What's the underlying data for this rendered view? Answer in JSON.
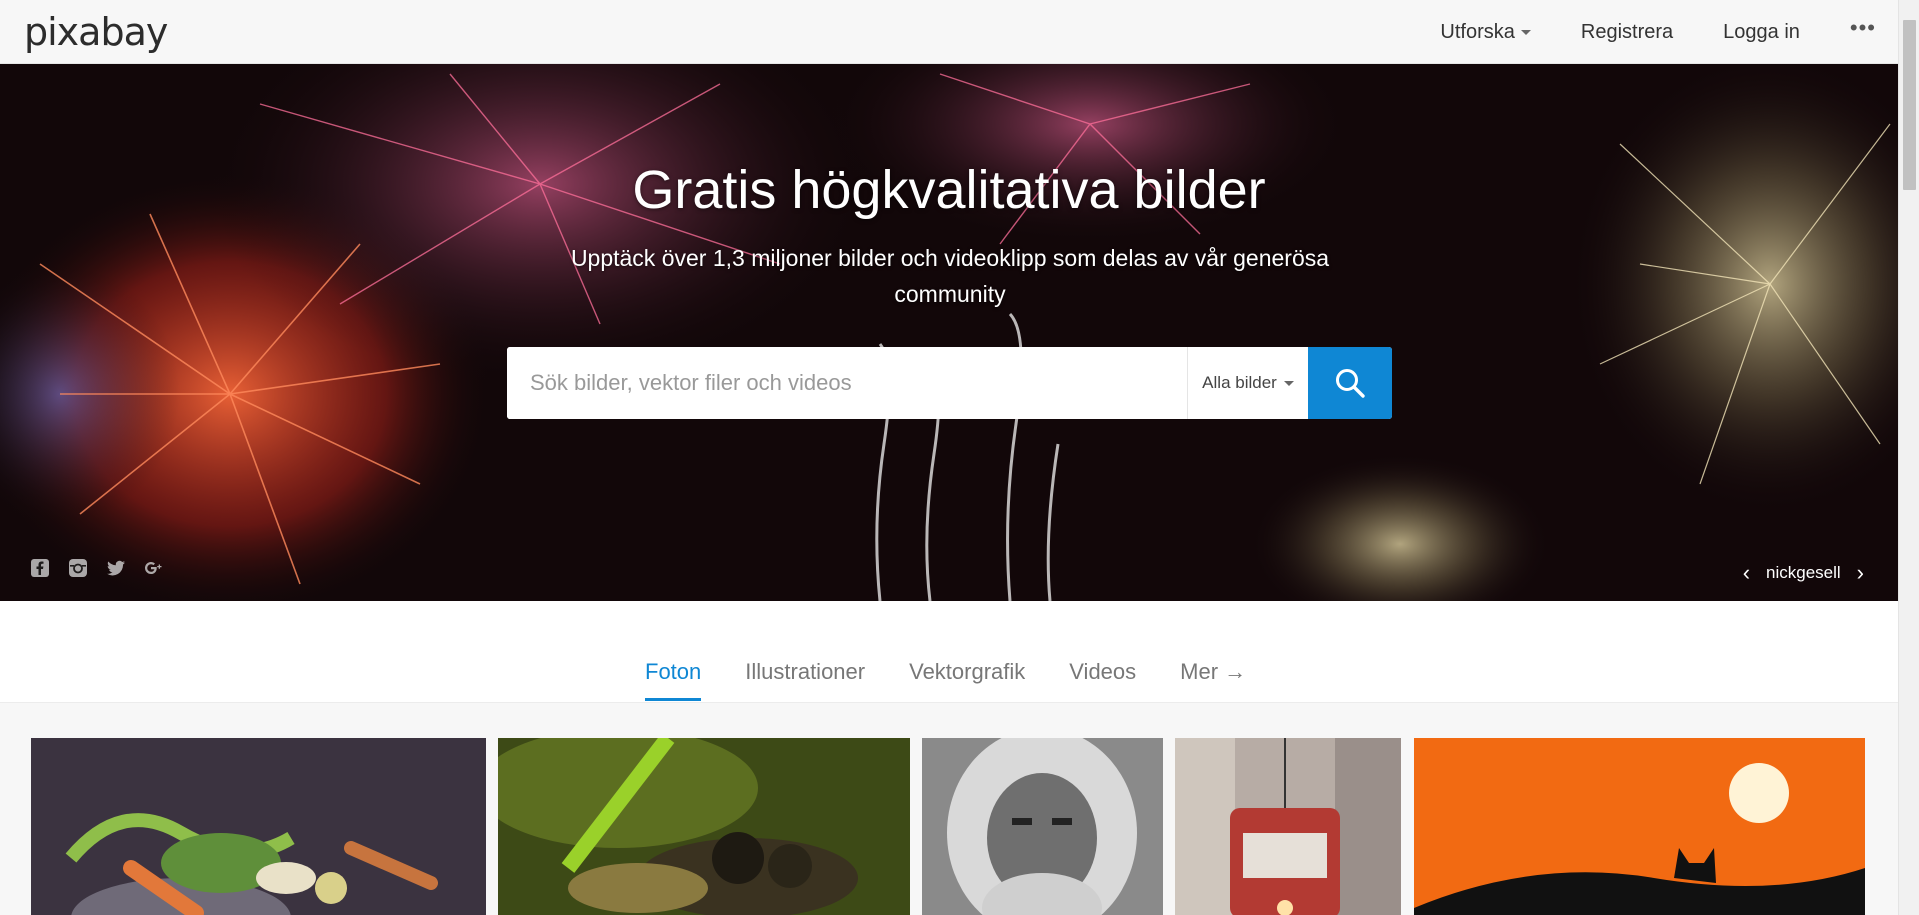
{
  "header": {
    "logo": "pixabay",
    "nav": [
      {
        "label": "Utforska",
        "dropdown": true
      },
      {
        "label": "Registrera"
      },
      {
        "label": "Logga in"
      }
    ],
    "more": "•••"
  },
  "hero": {
    "title": "Gratis högkvalitativa bilder",
    "subtitle": "Upptäck över 1,3 miljoner bilder och videoklipp som delas av vår generösa community",
    "search_placeholder": "Sök bilder, vektor filer och videos",
    "search_type": "Alla bilder",
    "credit_name": "nickgesell",
    "credit_prev": "‹",
    "credit_next": "›",
    "socials": [
      "facebook-icon",
      "instagram-icon",
      "twitter-icon",
      "google-plus-icon"
    ]
  },
  "tabs": [
    {
      "label": "Foton",
      "active": true
    },
    {
      "label": "Illustrationer"
    },
    {
      "label": "Vektorgrafik"
    },
    {
      "label": "Videos"
    },
    {
      "label": "Mer →"
    }
  ],
  "gallery": {
    "photos": [
      {
        "subject": "vegetables",
        "bg": "#3b3340"
      },
      {
        "subject": "insect-macro",
        "bg": "#4a5a1c"
      },
      {
        "subject": "old-man-portrait",
        "bg": "#7d7d7d"
      },
      {
        "subject": "tram-in-snow",
        "bg": "#b3a9a2"
      },
      {
        "subject": "cat-sunset",
        "bg": "#f26a12"
      }
    ]
  },
  "colors": {
    "accent": "#0f87d4",
    "header_bg": "#f7f7f7"
  }
}
